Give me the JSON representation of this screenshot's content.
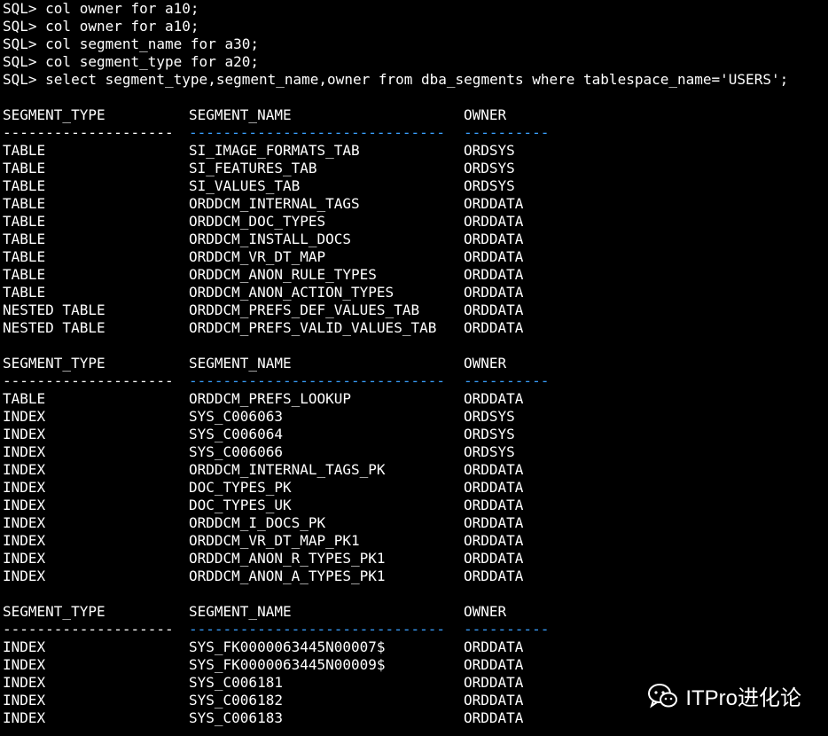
{
  "sql_lines": [
    "SQL> col owner for a10;",
    "SQL> col owner for a10;",
    "SQL> col segment_name for a30;",
    "SQL> col segment_type for a20;",
    "SQL> select segment_type,segment_name,owner from dba_segments where tablespace_name='USERS';"
  ],
  "columns": {
    "segment_type": "SEGMENT_TYPE",
    "segment_name": "SEGMENT_NAME",
    "owner": "OWNER"
  },
  "separators": {
    "segment_type": "--------------------",
    "segment_name": "------------------------------",
    "owner": "----------"
  },
  "result_blocks": [
    {
      "rows": [
        [
          "TABLE",
          "SI_IMAGE_FORMATS_TAB",
          "ORDSYS"
        ],
        [
          "TABLE",
          "SI_FEATURES_TAB",
          "ORDSYS"
        ],
        [
          "TABLE",
          "SI_VALUES_TAB",
          "ORDSYS"
        ],
        [
          "TABLE",
          "ORDDCM_INTERNAL_TAGS",
          "ORDDATA"
        ],
        [
          "TABLE",
          "ORDDCM_DOC_TYPES",
          "ORDDATA"
        ],
        [
          "TABLE",
          "ORDDCM_INSTALL_DOCS",
          "ORDDATA"
        ],
        [
          "TABLE",
          "ORDDCM_VR_DT_MAP",
          "ORDDATA"
        ],
        [
          "TABLE",
          "ORDDCM_ANON_RULE_TYPES",
          "ORDDATA"
        ],
        [
          "TABLE",
          "ORDDCM_ANON_ACTION_TYPES",
          "ORDDATA"
        ],
        [
          "NESTED TABLE",
          "ORDDCM_PREFS_DEF_VALUES_TAB",
          "ORDDATA"
        ],
        [
          "NESTED TABLE",
          "ORDDCM_PREFS_VALID_VALUES_TAB",
          "ORDDATA"
        ]
      ]
    },
    {
      "rows": [
        [
          "TABLE",
          "ORDDCM_PREFS_LOOKUP",
          "ORDDATA"
        ],
        [
          "INDEX",
          "SYS_C006063",
          "ORDSYS"
        ],
        [
          "INDEX",
          "SYS_C006064",
          "ORDSYS"
        ],
        [
          "INDEX",
          "SYS_C006066",
          "ORDSYS"
        ],
        [
          "INDEX",
          "ORDDCM_INTERNAL_TAGS_PK",
          "ORDDATA"
        ],
        [
          "INDEX",
          "DOC_TYPES_PK",
          "ORDDATA"
        ],
        [
          "INDEX",
          "DOC_TYPES_UK",
          "ORDDATA"
        ],
        [
          "INDEX",
          "ORDDCM_I_DOCS_PK",
          "ORDDATA"
        ],
        [
          "INDEX",
          "ORDDCM_VR_DT_MAP_PK1",
          "ORDDATA"
        ],
        [
          "INDEX",
          "ORDDCM_ANON_R_TYPES_PK1",
          "ORDDATA"
        ],
        [
          "INDEX",
          "ORDDCM_ANON_A_TYPES_PK1",
          "ORDDATA"
        ]
      ]
    },
    {
      "rows": [
        [
          "INDEX",
          "SYS_FK0000063445N00007$",
          "ORDDATA"
        ],
        [
          "INDEX",
          "SYS_FK0000063445N00009$",
          "ORDDATA"
        ],
        [
          "INDEX",
          "SYS_C006181",
          "ORDDATA"
        ],
        [
          "INDEX",
          "SYS_C006182",
          "ORDDATA"
        ],
        [
          "INDEX",
          "SYS_C006183",
          "ORDDATA"
        ]
      ]
    }
  ],
  "watermark": {
    "text": "ITPro进化论",
    "icon": "wechat-icon"
  },
  "colors": {
    "background": "#000000",
    "text": "#ffffff",
    "separator_accent": "#3aa0ff"
  }
}
